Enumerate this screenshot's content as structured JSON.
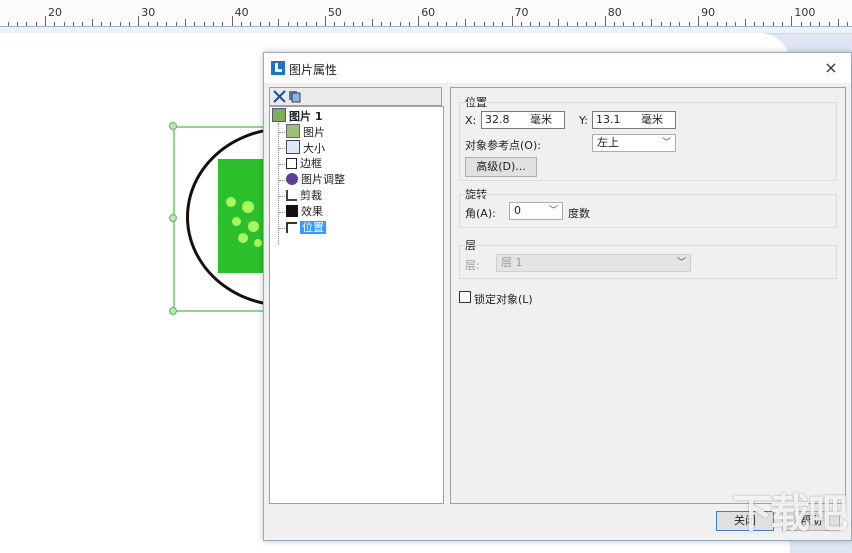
{
  "ruler": {
    "labels": [
      "20",
      "30",
      "40",
      "50",
      "60",
      "70",
      "80",
      "90",
      "100"
    ]
  },
  "dialog": {
    "title": "图片属性",
    "close_symbol": "×",
    "tree": {
      "root": "图片 1",
      "items": [
        "图片",
        "大小",
        "边框",
        "图片调整",
        "剪裁",
        "效果",
        "位置"
      ],
      "selected": "位置"
    },
    "position": {
      "group_title": "位置",
      "x_label": "X:",
      "x_value": "32.8",
      "x_unit": "毫米",
      "y_label": "Y:",
      "y_value": "13.1",
      "y_unit": "毫米",
      "ref_label": "对象参考点(O):",
      "ref_value": "左上",
      "advanced_button": "高级(D)..."
    },
    "rotation": {
      "group_title": "旋转",
      "angle_label": "角(A):",
      "angle_value": "0",
      "angle_unit": "度数"
    },
    "layer": {
      "group_title": "层",
      "layer_label": "层:",
      "layer_value": "层 1"
    },
    "lock_label": "锁定对象(L)",
    "close_button": "关闭",
    "help_button": "帮助"
  },
  "watermark": "下载吧",
  "colors": {
    "selection": "#3399ff",
    "canvas": "#ffffff",
    "green": "#2cc12c"
  }
}
